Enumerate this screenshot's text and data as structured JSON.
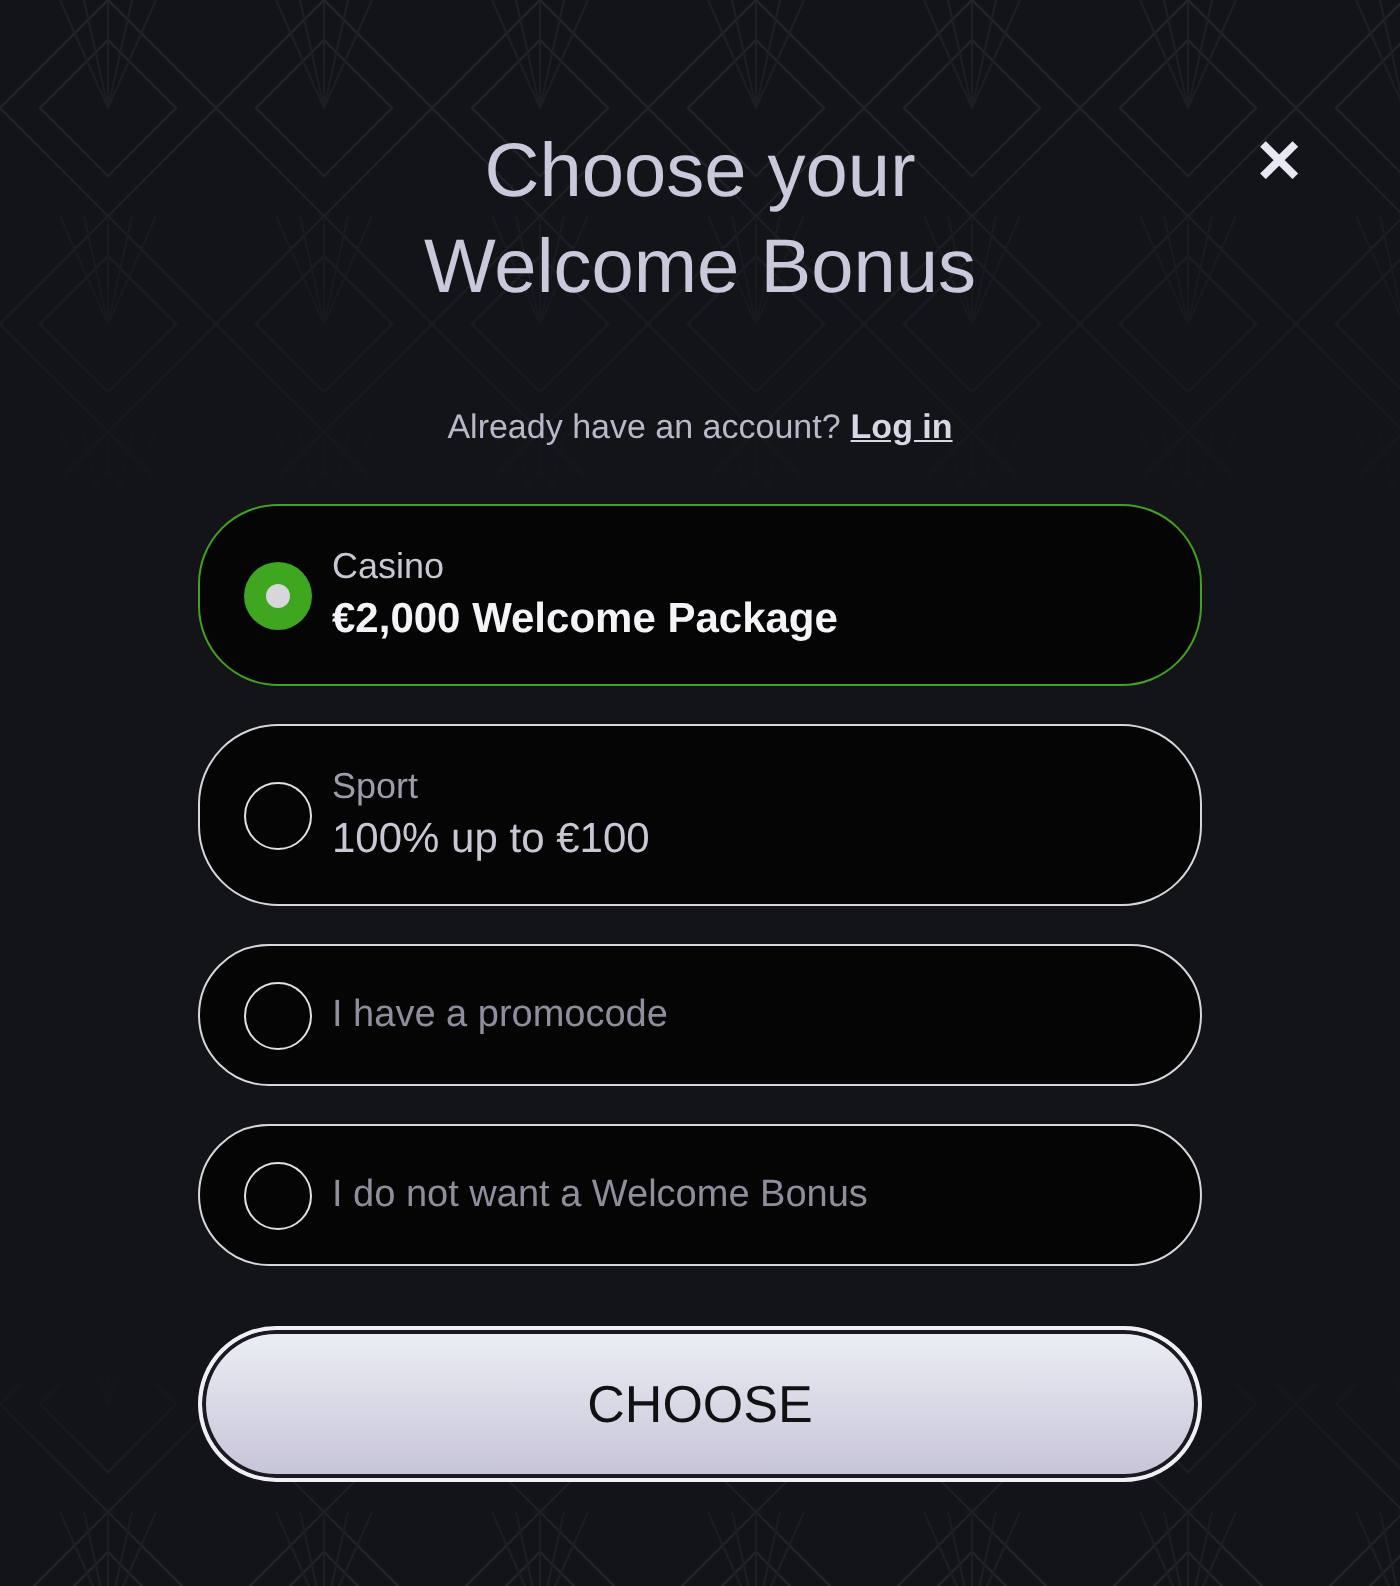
{
  "dialog": {
    "title": "Choose your Welcome Bonus",
    "close": "✕"
  },
  "login_prompt": {
    "text": "Already have an account?",
    "link": "Log in"
  },
  "options": [
    {
      "kind": "bonus",
      "category": "Casino",
      "title": "€2,000 Welcome Package",
      "selected": true
    },
    {
      "kind": "bonus",
      "category": "Sport",
      "title": "100% up to €100",
      "selected": false
    },
    {
      "kind": "plain",
      "label": "I have a promocode",
      "selected": false
    },
    {
      "kind": "plain",
      "label": "I do not want a Welcome Bonus",
      "selected": false
    }
  ],
  "button": "CHOOSE"
}
